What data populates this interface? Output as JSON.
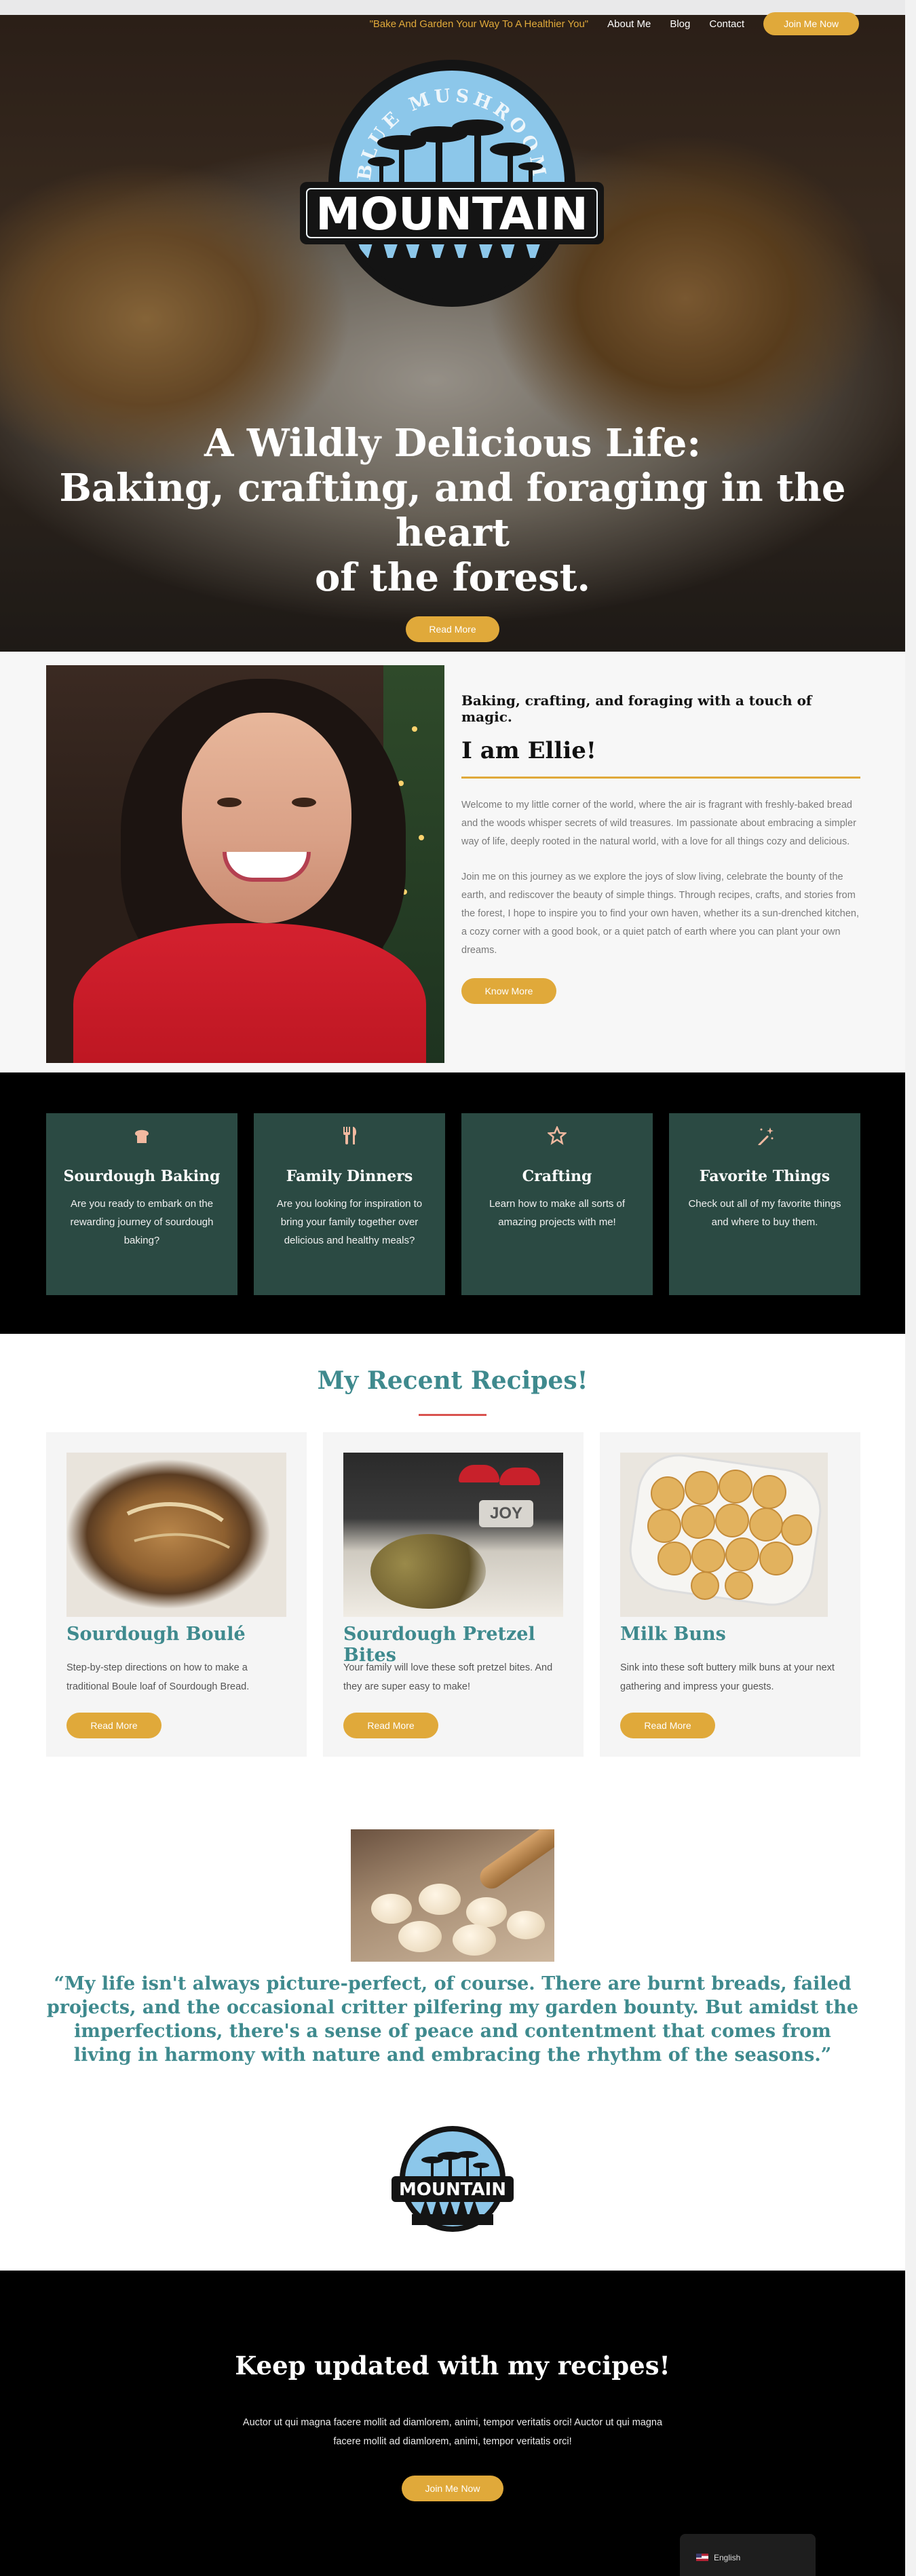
{
  "nav": {
    "tagline": "\"Bake And Garden Your Way To A Healthier You\"",
    "items": [
      "About Me",
      "Blog",
      "Contact"
    ],
    "cta": "Join Me Now"
  },
  "logo": {
    "arc_text": "BLUE MUSHROOM",
    "banner_text": "MOUNTAIN"
  },
  "hero": {
    "title_line1": "A Wildly Delicious Life:",
    "title_line2": "Baking, crafting, and foraging in the heart",
    "title_line3": "of the forest.",
    "button": "Read More"
  },
  "about": {
    "subtitle": "Baking, crafting, and foraging with a touch of magic.",
    "name": "I am Ellie!",
    "paragraph1": "Welcome to my little corner of the world, where the air is fragrant with freshly-baked bread and the woods whisper secrets of wild treasures. Im passionate about embracing a simpler way of life, deeply rooted in the natural world, with a love for all things cozy and delicious.",
    "paragraph2": "Join me on this journey as we explore the joys of slow living, celebrate the bounty of the earth, and rediscover the beauty of simple things. Through recipes, crafts, and stories from the forest, I hope to inspire you to find your own haven, whether its a sun-drenched kitchen, a cozy corner with a good book, or a quiet patch of earth where you can plant your own dreams.",
    "button": "Know More"
  },
  "features": [
    {
      "icon": "bread-icon",
      "title": "Sourdough Baking",
      "desc": "Are you ready to embark on the rewarding journey of sourdough baking?"
    },
    {
      "icon": "utensils-icon",
      "title": "Family Dinners",
      "desc": "Are you looking for inspiration to bring your family together over delicious and healthy meals?"
    },
    {
      "icon": "star-badge-icon",
      "title": "Crafting",
      "desc": "Learn how to make all sorts of amazing projects with me!"
    },
    {
      "icon": "magic-wand-icon",
      "title": "Favorite Things",
      "desc": "Check out all of my favorite things and where to buy them."
    }
  ],
  "recipes": {
    "heading": "My Recent Recipes!",
    "items": [
      {
        "title": "Sourdough Boulé",
        "desc": "Step-by-step directions on how to make a traditional Boule loaf of Sourdough Bread.",
        "button": "Read More"
      },
      {
        "title": "Sourdough Pretzel Bites",
        "desc": "Your family will love these soft pretzel bites. And they are super easy to make!",
        "button": "Read More",
        "sign_text": "JOY"
      },
      {
        "title": "Milk Buns",
        "desc": "Sink into these soft buttery milk buns at your next gathering and impress your guests.",
        "button": "Read More"
      }
    ]
  },
  "quote": {
    "text": "“My life isn't always picture-perfect, of course. There are burnt breads, failed projects, and the occasional critter pilfering my garden bounty. But amidst the imperfections, there's a sense of peace and contentment that comes from living in harmony with nature and embracing the rhythm of the seasons.”"
  },
  "newsletter": {
    "title": "Keep updated with my recipes!",
    "text": "Auctor ut qui magna facere mollit ad diamlorem, animi, tempor veritatis orci! Auctor ut qui magna facere mollit ad diamlorem, animi, tempor veritatis orci!",
    "button": "Join Me Now"
  },
  "language": {
    "current": "English"
  },
  "colors": {
    "accent_gold": "#e0a93a",
    "teal_heading": "#3f8a8e",
    "card_green": "#2b4a43",
    "rule_red": "#d9534f"
  }
}
